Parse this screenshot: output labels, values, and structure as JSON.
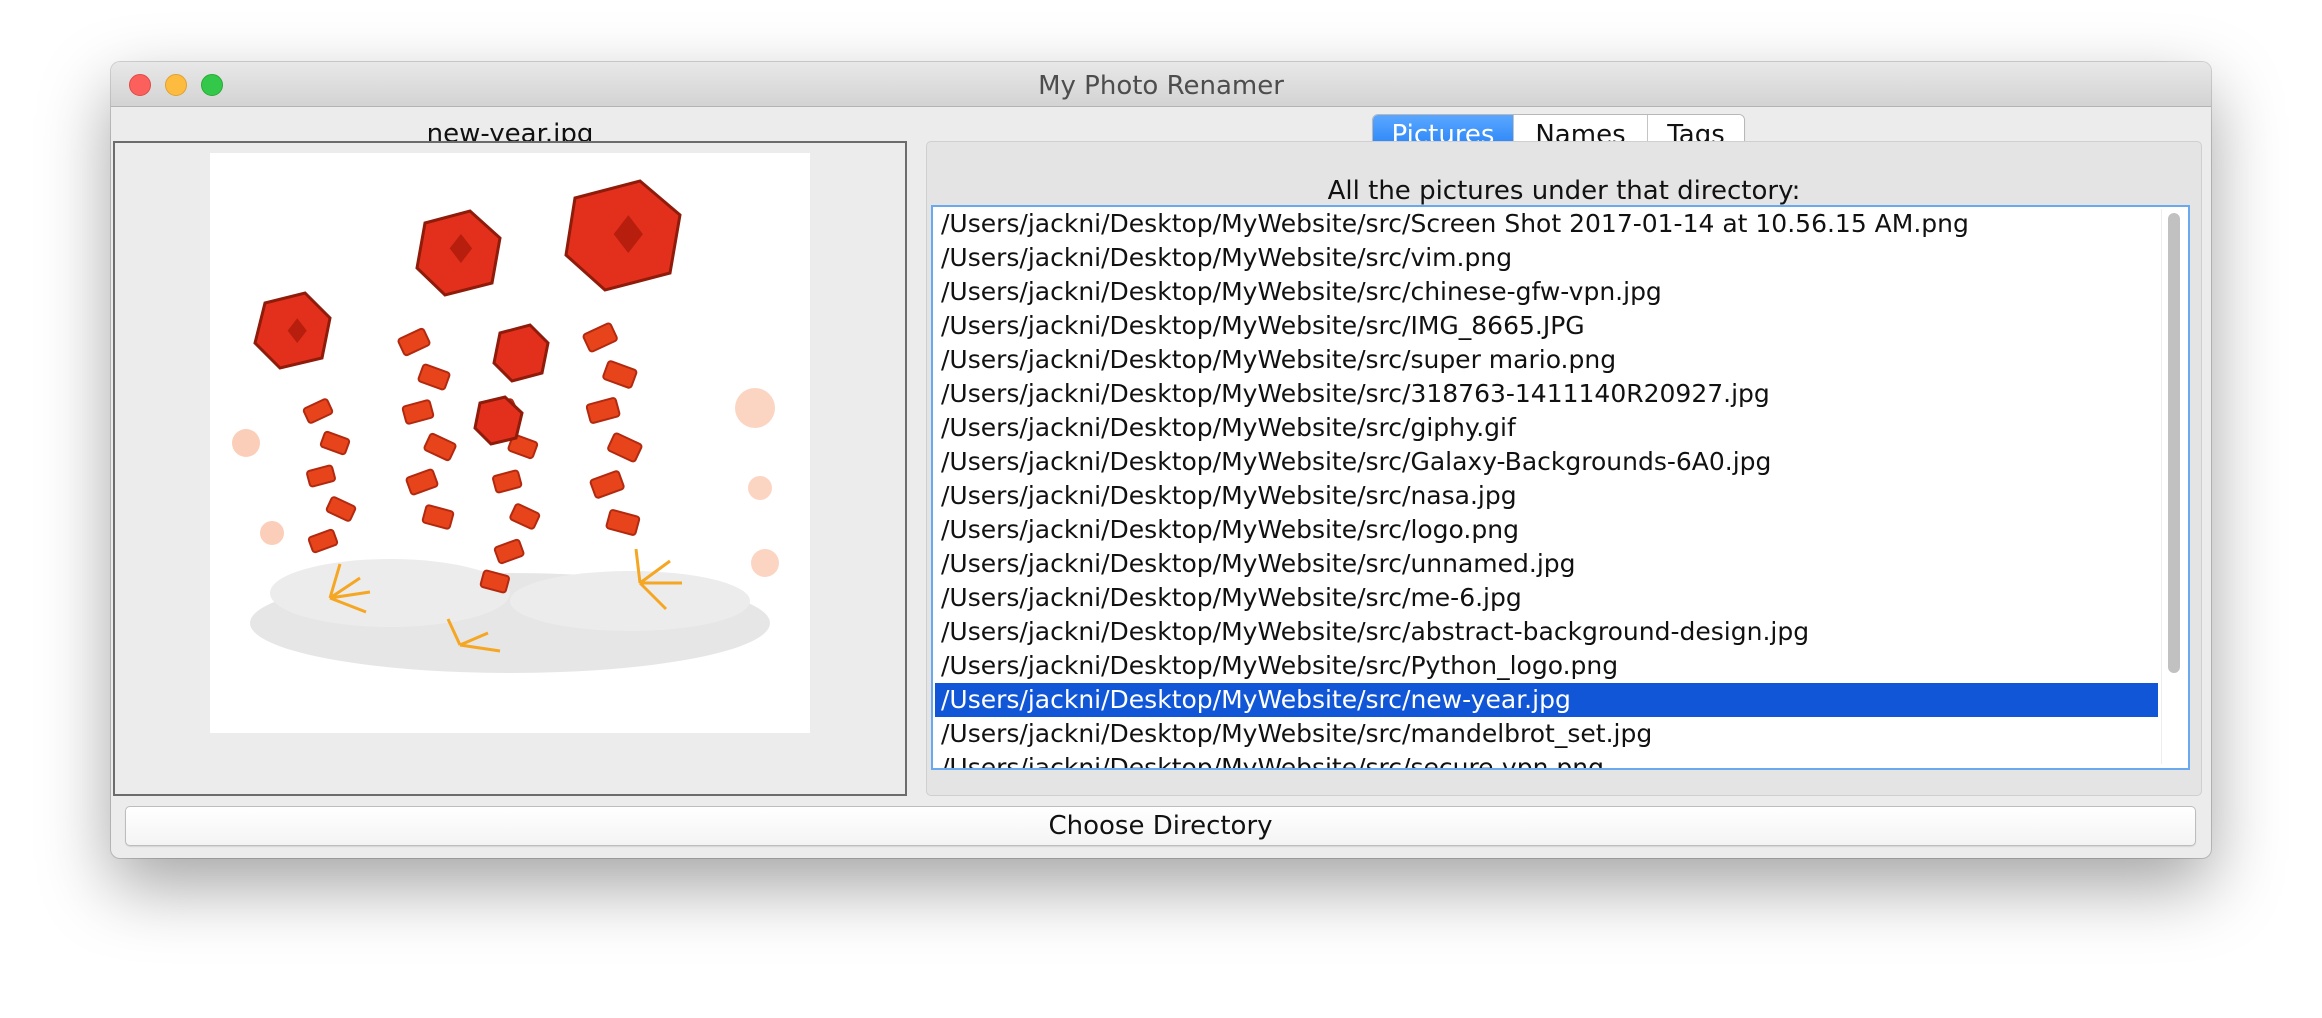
{
  "window": {
    "title": "My Photo Renamer"
  },
  "preview": {
    "filename": "new-year.jpg",
    "image_subject": "chinese-new-year-firecrackers"
  },
  "tabs": [
    {
      "label": "Pictures",
      "active": true
    },
    {
      "label": "Names",
      "active": false
    },
    {
      "label": "Tags",
      "active": false
    }
  ],
  "list": {
    "caption": "All the pictures under that directory:",
    "selected_index": 14,
    "items": [
      "/Users/jackni/Desktop/MyWebsite/src/Screen Shot 2017-01-14 at 10.56.15 AM.png",
      "/Users/jackni/Desktop/MyWebsite/src/vim.png",
      "/Users/jackni/Desktop/MyWebsite/src/chinese-gfw-vpn.jpg",
      "/Users/jackni/Desktop/MyWebsite/src/IMG_8665.JPG",
      "/Users/jackni/Desktop/MyWebsite/src/super mario.png",
      "/Users/jackni/Desktop/MyWebsite/src/318763-1411140R20927.jpg",
      "/Users/jackni/Desktop/MyWebsite/src/giphy.gif",
      "/Users/jackni/Desktop/MyWebsite/src/Galaxy-Backgrounds-6A0.jpg",
      "/Users/jackni/Desktop/MyWebsite/src/nasa.jpg",
      "/Users/jackni/Desktop/MyWebsite/src/logo.png",
      "/Users/jackni/Desktop/MyWebsite/src/unnamed.jpg",
      "/Users/jackni/Desktop/MyWebsite/src/me-6.jpg",
      "/Users/jackni/Desktop/MyWebsite/src/abstract-background-design.jpg",
      "/Users/jackni/Desktop/MyWebsite/src/Python_logo.png",
      "/Users/jackni/Desktop/MyWebsite/src/new-year.jpg",
      "/Users/jackni/Desktop/MyWebsite/src/mandelbrot_set.jpg",
      "/Users/jackni/Desktop/MyWebsite/src/secure-vpn.png"
    ]
  },
  "choose_button": {
    "label": "Choose Directory"
  },
  "colors": {
    "selection": "#1156d6",
    "tab_active": "#1f7df5",
    "list_focus_border": "#6aa9ee",
    "close": "#fc605c",
    "minimize": "#fdbc40",
    "zoom": "#34c84a"
  }
}
